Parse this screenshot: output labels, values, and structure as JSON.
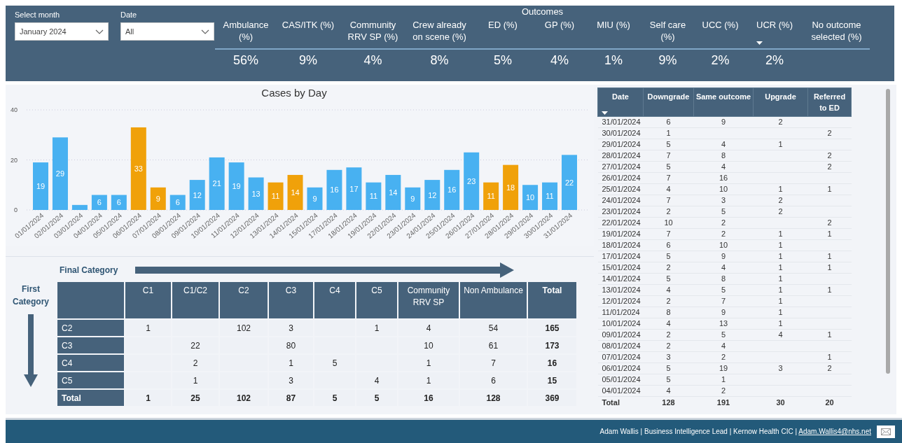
{
  "filters": [
    {
      "label": "Select month",
      "value": "January 2024"
    },
    {
      "label": "Date",
      "value": "All"
    }
  ],
  "outcomes": {
    "title": "Outcomes",
    "columns": [
      {
        "label": "Ambulance (%)",
        "value": "56%",
        "sorted": false
      },
      {
        "label": "CAS/ITK (%)",
        "value": "9%",
        "sorted": false
      },
      {
        "label": "Community RRV SP (%)",
        "value": "4%",
        "sorted": false
      },
      {
        "label": "Crew already on scene (%)",
        "value": "8%",
        "sorted": false
      },
      {
        "label": "ED (%)",
        "value": "5%",
        "sorted": false
      },
      {
        "label": "GP (%)",
        "value": "4%",
        "sorted": false
      },
      {
        "label": "MIU (%)",
        "value": "1%",
        "sorted": false
      },
      {
        "label": "Self care (%)",
        "value": "9%",
        "sorted": false
      },
      {
        "label": "UCC (%)",
        "value": "2%",
        "sorted": false
      },
      {
        "label": "UCR (%)",
        "value": "2%",
        "sorted": true
      },
      {
        "label": "No outcome selected (%)",
        "sorted": false
      }
    ]
  },
  "cases_chart": {
    "chart_data": {
      "type": "bar",
      "title": "Cases by Day",
      "categories": [
        "01/01/2024",
        "02/01/2024",
        "03/01/2024",
        "04/01/2024",
        "05/01/2024",
        "06/01/2024",
        "07/01/2024",
        "08/01/2024",
        "09/01/2024",
        "10/01/2024",
        "11/01/2024",
        "12/01/2024",
        "13/01/2024",
        "14/01/2024",
        "15/01/2024",
        "17/01/2024",
        "18/01/2024",
        "19/01/2024",
        "22/01/2024",
        "23/01/2024",
        "24/01/2024",
        "25/01/2024",
        "26/01/2024",
        "27/01/2024",
        "28/01/2024",
        "29/01/2024",
        "30/01/2024",
        "31/01/2024"
      ],
      "series": [
        {
          "color": "#48b1f1",
          "values": [
            19,
            29,
            2,
            6,
            6,
            null,
            null,
            6,
            12,
            21,
            19,
            13,
            null,
            null,
            9,
            16,
            17,
            11,
            14,
            9,
            12,
            16,
            23,
            null,
            null,
            10,
            11,
            22
          ]
        },
        {
          "color": "#f0a10a",
          "values": [
            null,
            null,
            null,
            null,
            null,
            33,
            9,
            null,
            null,
            null,
            null,
            null,
            11,
            14,
            null,
            null,
            null,
            null,
            null,
            null,
            null,
            null,
            null,
            11,
            18,
            null,
            null,
            null
          ]
        }
      ],
      "stacked": true,
      "ylim": [
        0,
        40
      ],
      "yticks": [
        0,
        20,
        40
      ],
      "value_labels": [
        "19",
        "29",
        null,
        "6",
        "6",
        "33",
        "9",
        "6",
        "12",
        "21",
        "19",
        "13",
        "11",
        "14",
        "9",
        "16",
        "17",
        "11",
        "14",
        "9",
        "12",
        "16",
        "23",
        "11",
        "18",
        "10",
        "11",
        "22"
      ]
    }
  },
  "category_matrix": {
    "column_axis_label": "Final Category",
    "row_axis_label": "First Category",
    "columns": [
      {
        "label": "C1",
        "kind": "value"
      },
      {
        "label": "C1/C2",
        "kind": "value"
      },
      {
        "label": "C2",
        "kind": "value"
      },
      {
        "label": "C3",
        "kind": "value"
      },
      {
        "label": "C4",
        "kind": "value"
      },
      {
        "label": "C5",
        "kind": "value"
      },
      {
        "label": "Community RRV SP",
        "kind": "value"
      },
      {
        "label": "Non Ambulance",
        "kind": "value"
      },
      {
        "label": "Total",
        "kind": "total"
      }
    ],
    "rows": [
      {
        "label": "C2",
        "kind": "value",
        "cells": [
          "1",
          null,
          "102",
          "3",
          null,
          "1",
          "4",
          "54",
          "165"
        ]
      },
      {
        "label": "C3",
        "kind": "value",
        "cells": [
          null,
          "22",
          null,
          "80",
          null,
          null,
          "10",
          "61",
          "173"
        ]
      },
      {
        "label": "C4",
        "kind": "value",
        "cells": [
          null,
          "2",
          null,
          "1",
          "5",
          null,
          "1",
          "7",
          "16"
        ]
      },
      {
        "label": "C5",
        "kind": "value",
        "cells": [
          null,
          "1",
          null,
          "3",
          null,
          "4",
          "1",
          "6",
          "15"
        ]
      },
      {
        "label": "Total",
        "kind": "total",
        "cells": [
          "1",
          "25",
          "102",
          "87",
          "5",
          "5",
          "16",
          "128",
          "369"
        ]
      }
    ]
  },
  "outcome_table": {
    "columns": [
      {
        "label": "Date",
        "sorted": true
      },
      {
        "label": "Downgrade",
        "sorted": false
      },
      {
        "label": "Same outcome",
        "sorted": false
      },
      {
        "label": "Upgrade",
        "sorted": false
      },
      {
        "label": "Referred to ED",
        "sorted": false
      }
    ],
    "rows": [
      [
        "31/01/2024",
        "6",
        "9",
        "2",
        null
      ],
      [
        "30/01/2024",
        "1",
        null,
        null,
        "2"
      ],
      [
        "29/01/2024",
        "5",
        "4",
        "1",
        null
      ],
      [
        "28/01/2024",
        "7",
        "8",
        null,
        "2"
      ],
      [
        "27/01/2024",
        "5",
        "4",
        null,
        "2"
      ],
      [
        "26/01/2024",
        "7",
        "16",
        null,
        null
      ],
      [
        "25/01/2024",
        "4",
        "10",
        "1",
        "1"
      ],
      [
        "24/01/2024",
        "7",
        "3",
        "2",
        null
      ],
      [
        "23/01/2024",
        "2",
        "5",
        "2",
        null
      ],
      [
        "22/01/2024",
        "10",
        "2",
        null,
        "2"
      ],
      [
        "19/01/2024",
        "7",
        "2",
        "1",
        "1"
      ],
      [
        "18/01/2024",
        "6",
        "10",
        "1",
        null
      ],
      [
        "17/01/2024",
        "5",
        "9",
        "1",
        "1"
      ],
      [
        "15/01/2024",
        "2",
        "4",
        "1",
        "1"
      ],
      [
        "14/01/2024",
        "5",
        "8",
        "1",
        null
      ],
      [
        "13/01/2024",
        "4",
        "5",
        "1",
        "1"
      ],
      [
        "12/01/2024",
        "2",
        "7",
        "1",
        null
      ],
      [
        "11/01/2024",
        "8",
        "9",
        "1",
        null
      ],
      [
        "10/01/2024",
        "4",
        "13",
        "1",
        null
      ],
      [
        "09/01/2024",
        "2",
        "5",
        "4",
        "1"
      ],
      [
        "08/01/2024",
        "2",
        "4",
        null,
        null
      ],
      [
        "07/01/2024",
        "3",
        "2",
        null,
        "1"
      ],
      [
        "06/01/2024",
        "5",
        "19",
        "3",
        "2"
      ],
      [
        "05/01/2024",
        "5",
        "1",
        null,
        null
      ],
      [
        "04/01/2024",
        "4",
        "2",
        null,
        null
      ]
    ],
    "total": [
      "Total",
      "128",
      "191",
      "30",
      "20"
    ]
  },
  "footer": {
    "credit": "Adam Wallis | Business Intelligence Lead | Kernow Health CIC |",
    "email": "Adam.Wallis4@nhs.net"
  }
}
